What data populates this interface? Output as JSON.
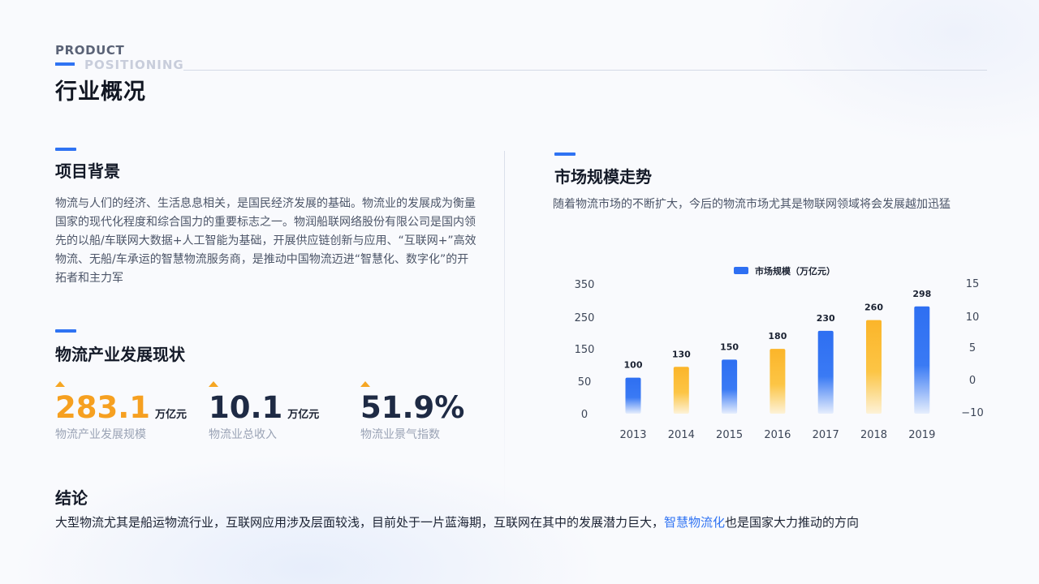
{
  "header": {
    "eyebrow_line1": "PRODUCT",
    "eyebrow_line2": "POSITIONING",
    "title": "行业概况"
  },
  "background": {
    "title": "项目背景",
    "body": "物流与人们的经济、生活息息相关，是国民经济发展的基础。物流业的发展成为衡量国家的现代化程度和综合国力的重要标志之一。物润船联网络股份有限公司是国内领先的以船/车联网大数据+人工智能为基础，开展供应链创新与应用、“互联网+”高效物流、无船/车承运的智慧物流服务商，是推动中国物流迈进“智慧化、数字化”的开拓者和主力军"
  },
  "status": {
    "title": "物流产业发展现状",
    "kpis": [
      {
        "value": "283.1",
        "unit": "万亿元",
        "label": "物流产业发展规模",
        "color": "#f6a020"
      },
      {
        "value": "10.1",
        "unit": "万亿元",
        "label": "物流业总收入",
        "color": "#1e2a44"
      },
      {
        "value": "51.9%",
        "unit": "",
        "label": "物流业景气指数",
        "color": "#1e2a44"
      }
    ],
    "trend_icon": "up-arrow-icon"
  },
  "trend": {
    "title": "市场规模走势",
    "description": "随着物流市场的不断扩大，今后的物流市场尤其是物联网领域将会发展越加迅猛"
  },
  "conclusion": {
    "title": "结论",
    "text_before": "大型物流尤其是船运物流行业，互联网应用涉及层面较浅，目前处于一片蓝海期，互联网在其中的发展潜力巨大，",
    "highlight": "智慧物流化",
    "text_after": "也是国家大力推动的方向"
  },
  "colors": {
    "accent_blue": "#2f73f3",
    "accent_orange": "#f6a623"
  },
  "chart_data": {
    "type": "bar",
    "title": "",
    "categories": [
      "2013",
      "2014",
      "2015",
      "2016",
      "2017",
      "2018",
      "2019"
    ],
    "series": [
      {
        "name": "市场规模（万亿元）",
        "values": [
          100,
          130,
          150,
          180,
          230,
          260,
          298
        ]
      }
    ],
    "bar_colors": [
      "blue",
      "orange",
      "blue",
      "orange",
      "blue",
      "orange",
      "blue"
    ],
    "y_left_ticks": [
      "350",
      "250",
      "150",
      "50",
      "0"
    ],
    "y_right_ticks": [
      "15",
      "10",
      "5",
      "0",
      "−10"
    ],
    "legend": "top-center",
    "grid": false
  }
}
